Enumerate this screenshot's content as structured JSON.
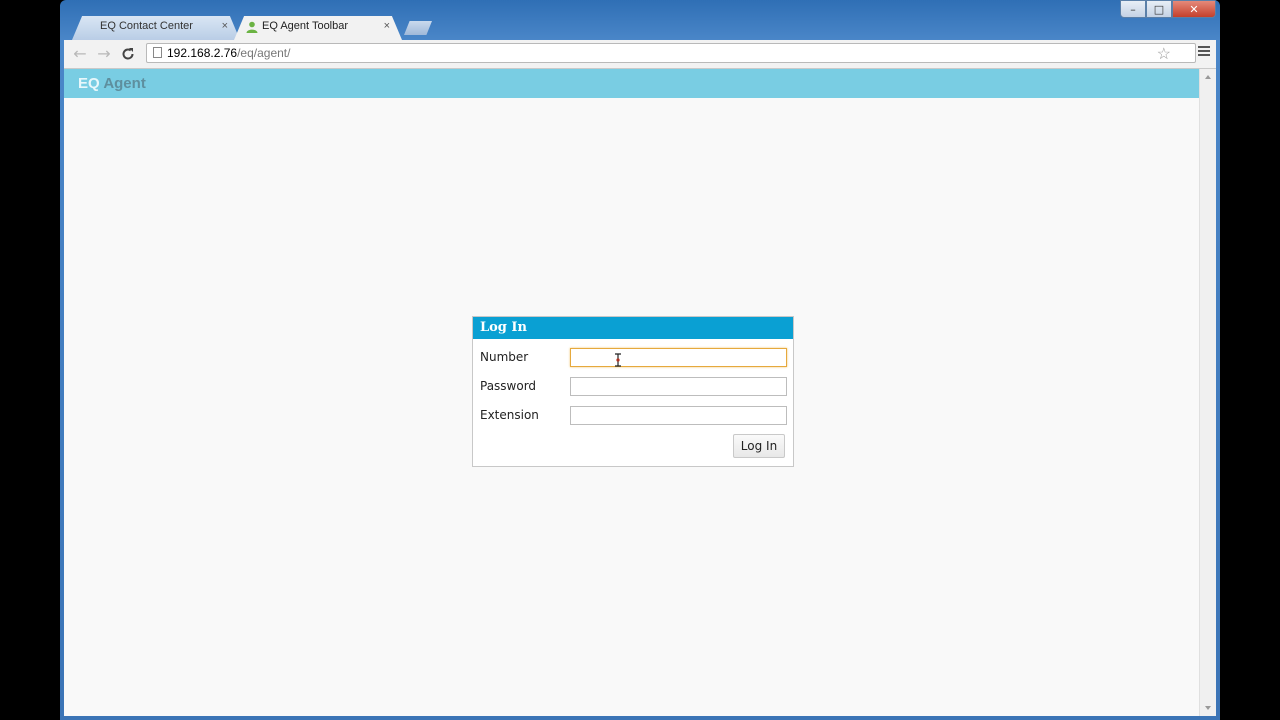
{
  "window": {
    "controls": {
      "minimize": "–",
      "maximize": "□",
      "close": "✕"
    }
  },
  "tabs": [
    {
      "title": "EQ Contact Center",
      "close": "×",
      "active": false
    },
    {
      "title": "EQ Agent Toolbar",
      "close": "×",
      "active": true,
      "favicon": "user-icon"
    }
  ],
  "toolbar": {
    "back": "←",
    "forward": "→",
    "reload": "C",
    "url_host": "192.168.2.76",
    "url_path": "/eq/agent/",
    "bookmark": "☆"
  },
  "app": {
    "title_eq": "EQ",
    "title_agent": "Agent",
    "header_color": "#79cde3"
  },
  "login": {
    "heading": "Log In",
    "fields": {
      "number_label": "Number",
      "number_value": "",
      "password_label": "Password",
      "password_value": "",
      "extension_label": "Extension",
      "extension_value": ""
    },
    "submit_label": "Log In",
    "header_color": "#0aa0d3"
  }
}
